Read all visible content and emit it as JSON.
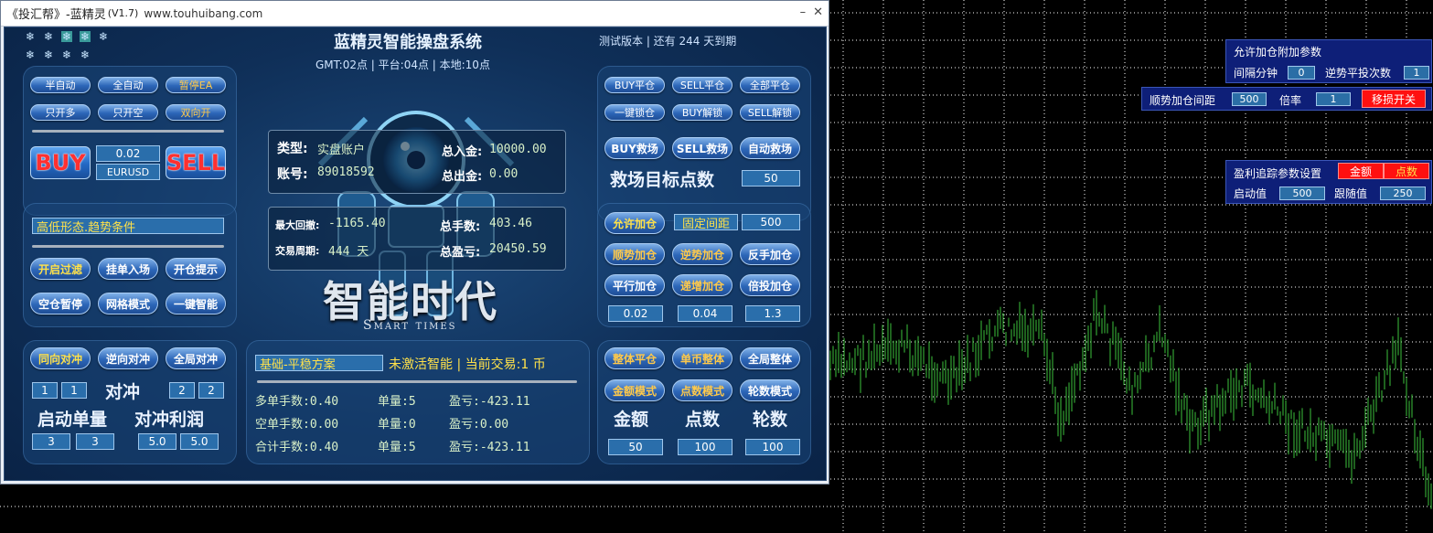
{
  "window": {
    "title": "《投汇帮》-蓝精灵",
    "version": "(V1.7)",
    "url": "www.touhuibang.com",
    "minimize_glyph": "–",
    "close_glyph": "✕"
  },
  "header": {
    "title": "蓝精灵智能操盘系统",
    "time_line": "GMT:02点 | 平台:04点 | 本地:10点",
    "trial_text": "测试版本 | 还有 244 天到期",
    "status_glyphs": [
      "❄",
      "❄",
      "❄",
      "❄",
      "❄",
      "❄",
      "❄",
      "❄",
      "❄"
    ]
  },
  "mode_buttons": {
    "semi_auto": "半自动",
    "full_auto": "全自动",
    "pause_ea": "暂停EA",
    "only_long": "只开多",
    "only_short": "只开空",
    "both": "双向开"
  },
  "trade": {
    "buy": "BUY",
    "sell": "SELL",
    "lot": "0.02",
    "symbol": "EURUSD"
  },
  "filter": {
    "condition": "高低形态.趋势条件",
    "open_filter": "开启过滤",
    "pending_entry": "挂单入场",
    "open_alert": "开仓提示",
    "empty_pause": "空仓暂停",
    "grid_mode": "网格模式",
    "one_key_smart": "一键智能"
  },
  "hedge": {
    "same_dir": "同向对冲",
    "reverse_dir": "逆向对冲",
    "global": "全局对冲",
    "label": "对冲",
    "v1": "1",
    "v2": "1",
    "v3": "2",
    "v4": "2",
    "start_lot_label": "启动单量",
    "profit_label": "对冲利润",
    "v5": "3",
    "v6": "3",
    "v7": "5.0",
    "v8": "5.0"
  },
  "account": {
    "type_label": "类型:",
    "type_value": "实盘账户",
    "acct_label": "账号:",
    "acct_value": "89018592",
    "deposit_label": "总入金:",
    "deposit_value": "10000.00",
    "withdraw_label": "总出金:",
    "withdraw_value": "0.00",
    "maxdd_label": "最大回撤:",
    "maxdd_value": "-1165.40",
    "period_label": "交易周期:",
    "period_value": "444 天",
    "lots_label": "总手数:",
    "lots_value": "403.46",
    "pnl_label": "总盈亏:",
    "pnl_value": "20450.59"
  },
  "brand": {
    "cn": "智能时代",
    "en": "Smart times"
  },
  "scheme": {
    "plan": "基础-平稳方案",
    "status": "未激活智能 | 当前交易:1 币",
    "rows": [
      {
        "a": "多单手数:0.40",
        "b": "单量:5",
        "c": "盈亏:-423.11"
      },
      {
        "a": "空单手数:0.00",
        "b": "单量:0",
        "c": "盈亏:0.00"
      },
      {
        "a": "合计手数:0.40",
        "b": "单量:5",
        "c": "盈亏:-423.11"
      }
    ]
  },
  "close_panel": {
    "buy_close": "BUY平仓",
    "sell_close": "SELL平仓",
    "all_close": "全部平仓",
    "lock": "一键锁仓",
    "buy_unlock": "BUY解锁",
    "sell_unlock": "SELL解锁",
    "buy_rescue": "BUY救场",
    "sell_rescue": "SELL救场",
    "auto_rescue": "自动救场",
    "rescue_target": "救场目标点数",
    "rescue_value": "50"
  },
  "add_panel": {
    "allow_add": "允许加仓",
    "fixed_gap": "固定间距",
    "gap_value": "500",
    "trend_add": "顺势加仓",
    "counter_add": "逆势加仓",
    "reverse_add": "反手加仓",
    "flat_add": "平行加仓",
    "incr_add": "递增加仓",
    "multi_add": "倍投加仓",
    "v1": "0.02",
    "v2": "0.04",
    "v3": "1.3"
  },
  "total_panel": {
    "whole_close": "整体平仓",
    "single_whole": "单币整体",
    "global_whole": "全局整体",
    "amount_mode": "金额模式",
    "points_mode": "点数模式",
    "rounds_mode": "轮数模式",
    "amount": "金额",
    "points": "点数",
    "rounds": "轮数",
    "v1": "50",
    "v2": "100",
    "v3": "100"
  },
  "overlay1": {
    "title": "允许加仓附加参数",
    "interval_label": "间隔分钟",
    "interval_value": "0",
    "counter_label": "逆势平投次数",
    "counter_value": "1"
  },
  "overlay2": {
    "gap_label": "顺势加仓间距",
    "gap_value": "500",
    "ratio_label": "倍率",
    "ratio_value": "1",
    "switch": "移损开关"
  },
  "overlay3": {
    "title": "盈利追踪参数设置",
    "amount_btn": "金额",
    "points_btn": "点数",
    "start_label": "启动值",
    "start_value": "500",
    "follow_label": "跟随值",
    "follow_value": "250"
  },
  "colors": {
    "chart_line": "#3cc23c",
    "grid": "#ffffff",
    "accent": "#ff1010"
  }
}
